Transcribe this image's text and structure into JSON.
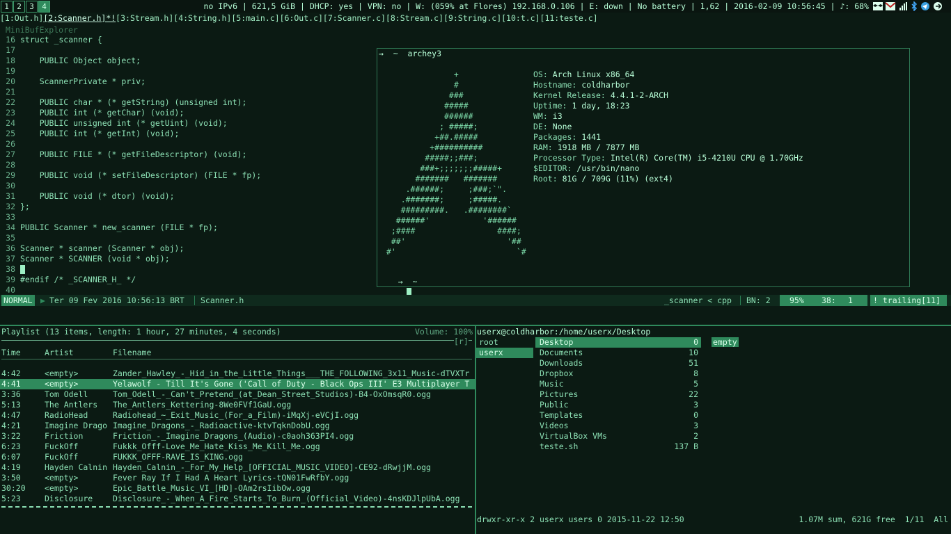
{
  "workspaces": [
    "1",
    "2",
    "3",
    "4"
  ],
  "active_workspace": "4",
  "status_bar": "no IPv6 | 621,5 GiB | DHCP: yes | VPN: no | W: (059% at Flores) 192.168.0.106 | E: down | No battery | 1,62 | 2016-02-09 10:56:45 | ♪: 68%",
  "tray_icons": [
    "dropbox-icon",
    "mail-icon",
    "signal-icon",
    "bluetooth-icon",
    "telegram-icon",
    "arrow-icon"
  ],
  "vim": {
    "tabs": [
      "[1:Out.h]",
      "[2:Scanner.h]*!",
      "[3:Stream.h]",
      "[4:String.h]",
      "[5:main.c]",
      "[6:Out.c]",
      "[7:Scanner.c]",
      "[8:Stream.c]",
      "[9:String.c]",
      "[10:t.c]",
      "[11:teste.c]"
    ],
    "active_tab": 1,
    "minibuf_title": "MiniBufExplorer",
    "code_lines": [
      {
        "n": "16",
        "t": "struct _scanner {"
      },
      {
        "n": "17",
        "t": ""
      },
      {
        "n": "18",
        "t": "    PUBLIC Object object;"
      },
      {
        "n": "19",
        "t": ""
      },
      {
        "n": "20",
        "t": "    ScannerPrivate * priv;"
      },
      {
        "n": "21",
        "t": ""
      },
      {
        "n": "22",
        "t": "    PUBLIC char * (* getString) (unsigned int);"
      },
      {
        "n": "23",
        "t": "    PUBLIC int (* getChar) (void);"
      },
      {
        "n": "24",
        "t": "    PUBLIC unsigned int (* getUint) (void);"
      },
      {
        "n": "25",
        "t": "    PUBLIC int (* getInt) (void);"
      },
      {
        "n": "26",
        "t": ""
      },
      {
        "n": "27",
        "t": "    PUBLIC FILE * (* getFileDescriptor) (void);"
      },
      {
        "n": "28",
        "t": ""
      },
      {
        "n": "29",
        "t": "    PUBLIC void (* setFileDescriptor) (FILE * fp);"
      },
      {
        "n": "30",
        "t": ""
      },
      {
        "n": "31",
        "t": "    PUBLIC void (* dtor) (void);"
      },
      {
        "n": "32",
        "t": "};"
      },
      {
        "n": "33",
        "t": ""
      },
      {
        "n": "34",
        "t": "PUBLIC Scanner * new_scanner (FILE * fp);"
      },
      {
        "n": "35",
        "t": ""
      },
      {
        "n": "36",
        "t": "Scanner * scanner (Scanner * obj);"
      },
      {
        "n": "37",
        "t": "Scanner * SCANNER (void * obj);"
      },
      {
        "n": "38",
        "t": ""
      },
      {
        "n": "39",
        "t": "#endif /* _SCANNER_H_ */"
      },
      {
        "n": "40",
        "t": ""
      }
    ],
    "status": {
      "mode": "NORMAL",
      "datetime": "Ter 09 Fev 2016 10:56:13 BRT",
      "filename": "Scanner.h",
      "tag": "_scanner < cpp",
      "buffer": "BN: 2",
      "percent": "95%",
      "line": "38:",
      "col": "1",
      "trailing": "! trailing[11]"
    }
  },
  "terminal": {
    "prompt1": "→  ~  archey3",
    "art": [
      "               +",
      "               #",
      "              ###",
      "             #####",
      "             ######",
      "            ; #####;",
      "           +##.#####",
      "          +##########",
      "         #####;;###;",
      "        ###+;;;;;;;#####+",
      "       #######   #######",
      "     .######;     ;###;`\".",
      "    .#######;     ;#####.",
      "    #########.   .########`",
      "   ######'           '######",
      "  ;####                 ####;",
      "  ##'                     '##",
      " #'                         `#"
    ],
    "info": [
      {
        "k": "OS:",
        "v": "Arch Linux x86_64"
      },
      {
        "k": "Hostname:",
        "v": "coldharbor"
      },
      {
        "k": "Kernel Release:",
        "v": "4.4.1-2-ARCH"
      },
      {
        "k": "Uptime:",
        "v": "1 day, 18:23"
      },
      {
        "k": "WM:",
        "v": "i3"
      },
      {
        "k": "DE:",
        "v": "None"
      },
      {
        "k": "Packages:",
        "v": "1441"
      },
      {
        "k": "RAM:",
        "v": "1918 MB / 7877 MB"
      },
      {
        "k": "Processor Type:",
        "v": "Intel(R) Core(TM) i5-4210U CPU @ 1.70GHz"
      },
      {
        "k": "$EDITOR:",
        "v": "/usr/bin/nano"
      },
      {
        "k": "Root:",
        "v": "81G / 709G (11%) (ext4)"
      }
    ],
    "prompt2": "→  ~"
  },
  "ncmpcpp": {
    "header": "Playlist (13 items, length: 1 hour, 27 minutes, 4 seconds)",
    "volume": "Volume: 100%",
    "flags": "[r]",
    "columns": [
      "Time",
      "Artist",
      "Filename"
    ],
    "rows": [
      {
        "time": "4:42",
        "artist": "<empty>",
        "file": "Zander_Hawley_-_Hid_in_the_Little_Things___THE_FOLLOWING_3x11_Music-dTVXTr"
      },
      {
        "time": "4:41",
        "artist": "<empty>",
        "file": "Yelawolf - Till It's Gone ('Call of Duty - Black Ops III' E3 Multiplayer T"
      },
      {
        "time": "3:36",
        "artist": "Tom Odell",
        "file": "Tom_Odell_-_Can't_Pretend_(at_Dean_Street_Studios)-B4-OxOmsqR0.ogg"
      },
      {
        "time": "5:13",
        "artist": "The Antlers",
        "file": "The_Antlers_Kettering-8We0FVf1GaU.ogg"
      },
      {
        "time": "4:47",
        "artist": "RadioHead",
        "file": "Radiohead_~_Exit_Music_(For_a_Film)-iMqXj-eVCjI.ogg"
      },
      {
        "time": "4:21",
        "artist": "Imagine Drago",
        "file": "Imagine_Dragons_-_Radioactive-ktvTqknDobU.ogg"
      },
      {
        "time": "3:22",
        "artist": "Friction",
        "file": "Friction_-_Imagine_Dragons_(Audio)-c0aoh363PI4.ogg"
      },
      {
        "time": "6:23",
        "artist": "FuckOff",
        "file": "Fukkk_Offf-Love_Me_Hate_Kiss_Me_Kill_Me.ogg"
      },
      {
        "time": "6:07",
        "artist": "FuckOff",
        "file": "FUKKK_OFFF-RAVE_IS_KING.ogg"
      },
      {
        "time": "4:19",
        "artist": "Hayden Calnin",
        "file": "Hayden_Calnin_-_For_My_Help_[OFFICIAL_MUSIC_VIDEO]-CE92-dRwjjM.ogg"
      },
      {
        "time": "3:50",
        "artist": "<empty>",
        "file": "Fever Ray   If I Had A Heart   Lyrics-tQN01FwRfbY.ogg"
      },
      {
        "time": "30:20",
        "artist": "<empty>",
        "file": "Epic_Battle_Music_VI_[HD]-OAm2rsIibOw.ogg"
      },
      {
        "time": "5:23",
        "artist": "Disclosure",
        "file": "Disclosure_-_When_A_Fire_Starts_To_Burn_(Official_Video)-4nsKDJlpUbA.ogg"
      }
    ],
    "selected_row": 1
  },
  "ranger": {
    "path": "userx@coldharbor:/home/userx/Desktop",
    "parent_col": [
      "root",
      "userx"
    ],
    "current_col": [
      {
        "name": "Desktop",
        "size": "0"
      },
      {
        "name": "Documents",
        "size": "10"
      },
      {
        "name": "Downloads",
        "size": "51"
      },
      {
        "name": "Dropbox",
        "size": "8"
      },
      {
        "name": "Music",
        "size": "5"
      },
      {
        "name": "Pictures",
        "size": "22"
      },
      {
        "name": "Public",
        "size": "3"
      },
      {
        "name": "Templates",
        "size": "0"
      },
      {
        "name": "Videos",
        "size": "3"
      },
      {
        "name": "VirtualBox VMs",
        "size": "2"
      },
      {
        "name": "teste.sh",
        "size": "137 B"
      }
    ],
    "preview": "empty",
    "perms": "drwxr-xr-x 2 userx users 0 2015-11-22 12:50",
    "summary": "1.07M sum, 621G free  1/11  All"
  }
}
